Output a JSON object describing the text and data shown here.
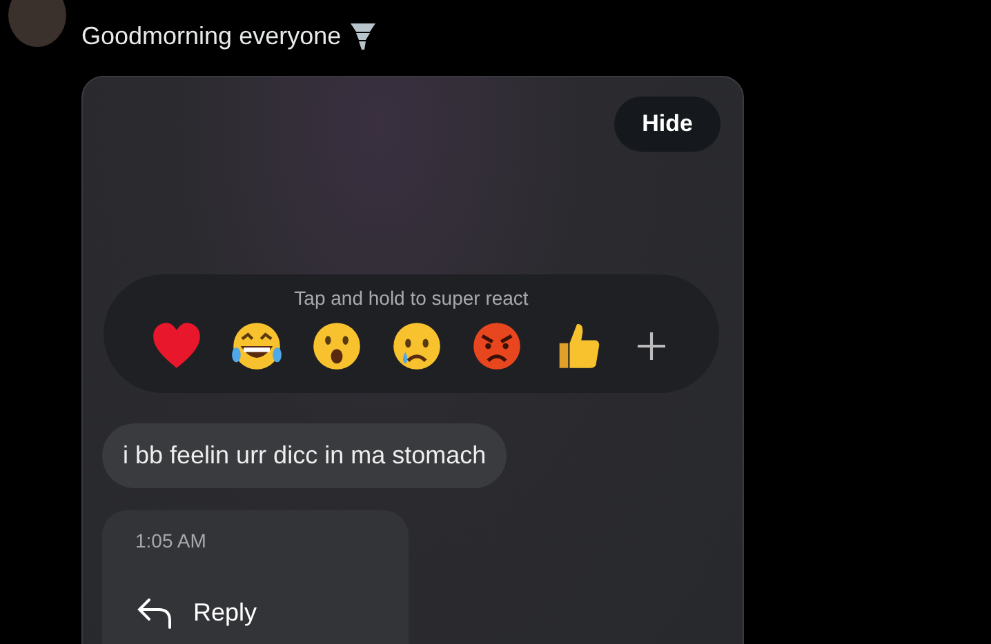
{
  "post": {
    "text": "Goodmorning everyone"
  },
  "overlay": {
    "hide_button": "Hide",
    "reaction_hint": "Tap and hold to super react",
    "reactions": [
      {
        "kind": "heart"
      },
      {
        "kind": "laugh"
      },
      {
        "kind": "wow"
      },
      {
        "kind": "sad"
      },
      {
        "kind": "angry"
      },
      {
        "kind": "thumbs"
      },
      {
        "kind": "more"
      }
    ],
    "message": "i bb feelin urr dicc in ma stomach",
    "menu": {
      "time": "1:05 AM",
      "items": [
        {
          "kind": "reply",
          "label": "Reply"
        }
      ]
    }
  }
}
